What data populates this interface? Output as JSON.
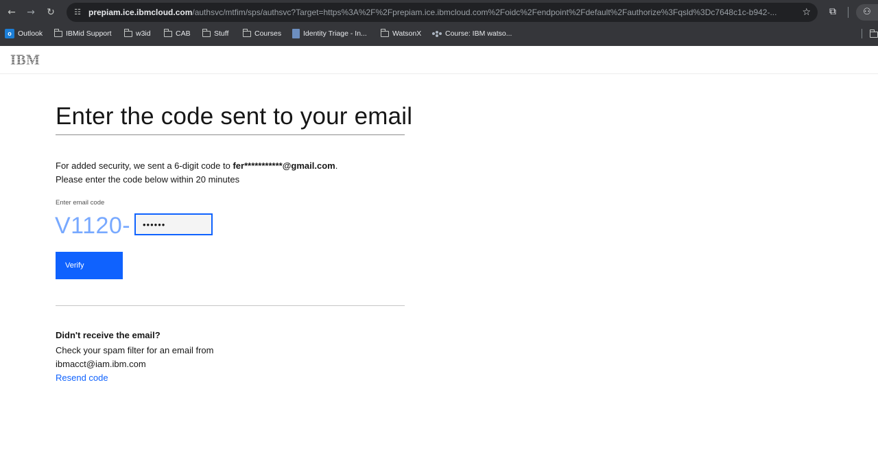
{
  "browser": {
    "url_host": "prepiam.ice.ibmcloud.com",
    "url_path": "/authsvc/mtfim/sps/authsvc?Target=https%3A%2F%2Fprepiam.ice.ibmcloud.com%2Foidc%2Fendpoint%2Fdefault%2Fauthorize%3Fqsld%3Dc7648c1c-b942-...",
    "bookmarks": [
      {
        "label": "Outlook",
        "icon": "outlook-icon"
      },
      {
        "label": "IBMid Support",
        "icon": "folder-icon"
      },
      {
        "label": "w3id",
        "icon": "folder-icon"
      },
      {
        "label": "CAB",
        "icon": "folder-icon"
      },
      {
        "label": "Stuff",
        "icon": "folder-icon"
      },
      {
        "label": "Courses",
        "icon": "folder-icon"
      },
      {
        "label": "Identity Triage - In...",
        "icon": "sheet-icon"
      },
      {
        "label": "WatsonX",
        "icon": "folder-icon"
      },
      {
        "label": "Course: IBM watso...",
        "icon": "course-icon"
      }
    ]
  },
  "header": {
    "logo": "IBM"
  },
  "main": {
    "title": "Enter the code sent to your email",
    "desc_prefix": "For added security, we sent a 6-digit code to ",
    "masked_email": "fer***********@gmail.com",
    "desc_suffix": ".",
    "desc_line2": "Please enter the code below within 20 minutes",
    "field_label": "Enter email code",
    "code_prefix": "V1120-",
    "code_value": "••••••",
    "verify_label": "Verify"
  },
  "help": {
    "title": "Didn't receive the email?",
    "line1": "Check your spam filter for an email from",
    "line2": "ibmacct@iam.ibm.com",
    "resend_label": "Resend code"
  },
  "colors": {
    "primary": "#0f62fe",
    "prefix": "#78a9ff",
    "chrome": "#35363a"
  }
}
